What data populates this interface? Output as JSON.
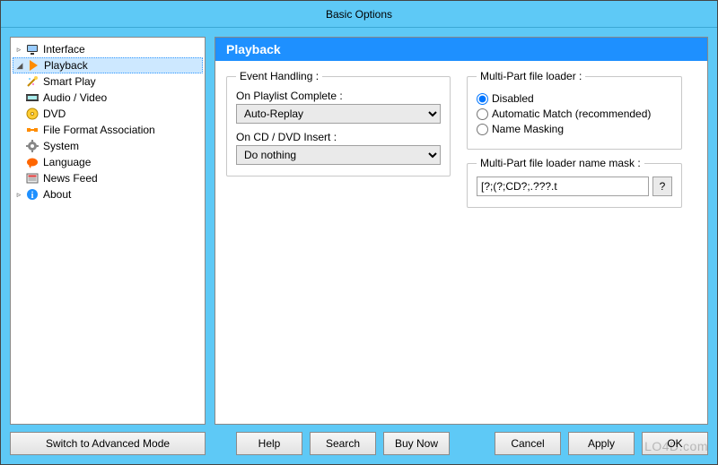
{
  "window": {
    "title": "Basic Options"
  },
  "tree": {
    "items": [
      {
        "label": "Interface",
        "expander": "▹"
      },
      {
        "label": "Playback",
        "expander": "◢"
      },
      {
        "label": "Smart Play"
      },
      {
        "label": "Audio / Video"
      },
      {
        "label": "DVD"
      },
      {
        "label": "File Format Association"
      },
      {
        "label": "System"
      },
      {
        "label": "Language"
      },
      {
        "label": "News Feed"
      },
      {
        "label": "About",
        "expander": "▹"
      }
    ]
  },
  "panel": {
    "title": "Playback"
  },
  "event_handling": {
    "legend": "Event Handling :",
    "playlist_label": "On Playlist Complete :",
    "playlist_value": "Auto-Replay",
    "cddvd_label": "On CD / DVD Insert :",
    "cddvd_value": "Do nothing"
  },
  "multipart": {
    "legend": "Multi-Part file loader :",
    "opt_disabled": "Disabled",
    "opt_auto": "Automatic Match (recommended)",
    "opt_mask": "Name Masking",
    "mask_legend": "Multi-Part file loader name mask :",
    "mask_value": "[?;(?;CD?;.???.t",
    "help_btn": "?"
  },
  "buttons": {
    "switch_mode": "Switch to Advanced Mode",
    "help": "Help",
    "search": "Search",
    "buy": "Buy Now",
    "cancel": "Cancel",
    "apply": "Apply",
    "ok": "OK"
  },
  "watermark": "LO4D.com"
}
